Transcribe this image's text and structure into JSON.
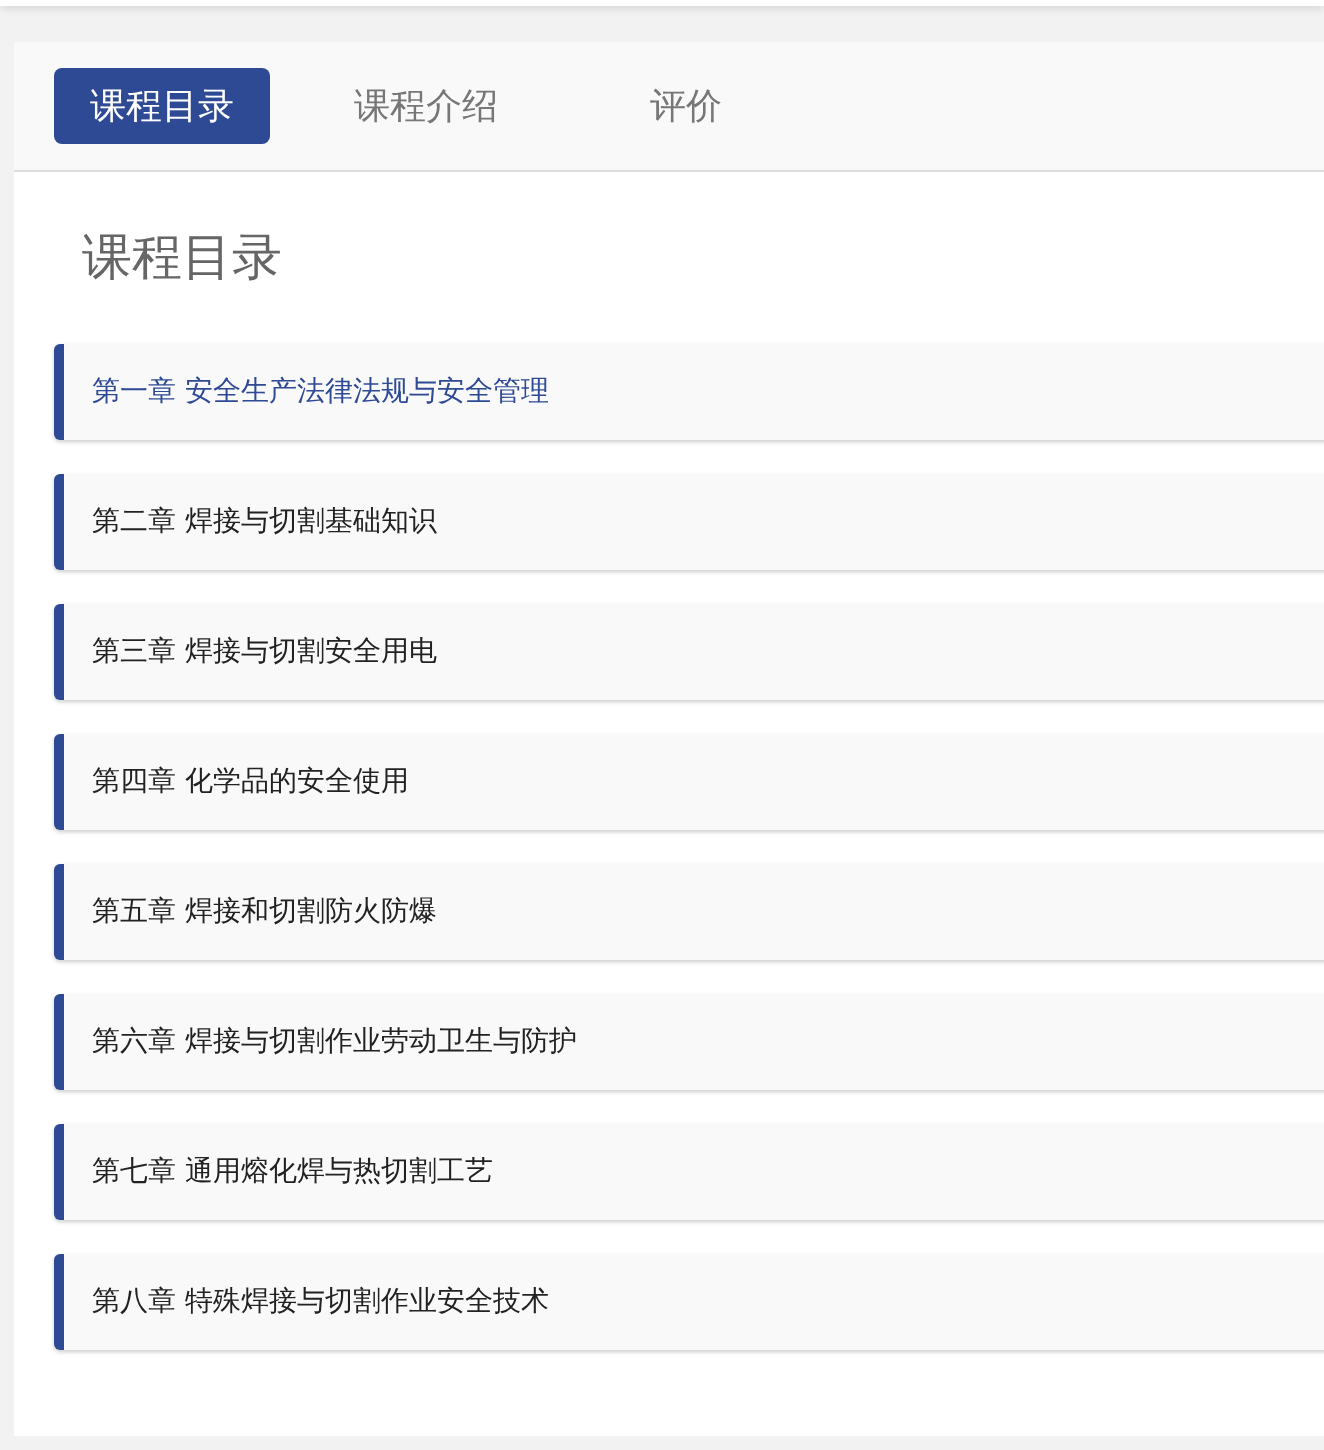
{
  "tabs": [
    {
      "label": "课程目录",
      "selected": true
    },
    {
      "label": "课程介绍",
      "selected": false
    },
    {
      "label": "评价",
      "selected": false
    }
  ],
  "heading": "课程目录",
  "chapters": [
    {
      "title": "第一章 安全生产法律法规与安全管理",
      "selected": true
    },
    {
      "title": "第二章 焊接与切割基础知识",
      "selected": false
    },
    {
      "title": "第三章 焊接与切割安全用电",
      "selected": false
    },
    {
      "title": "第四章 化学品的安全使用",
      "selected": false
    },
    {
      "title": "第五章 焊接和切割防火防爆",
      "selected": false
    },
    {
      "title": "第六章 焊接与切割作业劳动卫生与防护",
      "selected": false
    },
    {
      "title": "第七章 通用熔化焊与热切割工艺",
      "selected": false
    },
    {
      "title": "第八章 特殊焊接与切割作业安全技术",
      "selected": false
    }
  ]
}
